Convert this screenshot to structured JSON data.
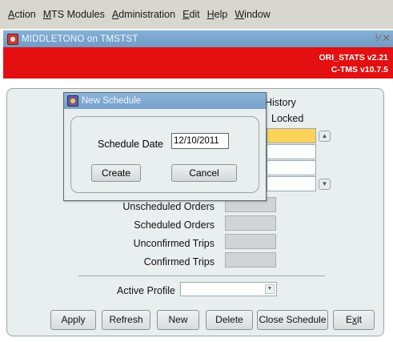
{
  "menubar": {
    "items": [
      {
        "prefix": "",
        "accel": "A",
        "rest": "ction"
      },
      {
        "prefix": "",
        "accel": "M",
        "rest": "TS Modules"
      },
      {
        "prefix": "",
        "accel": "A",
        "rest": "dministration"
      },
      {
        "prefix": "",
        "accel": "E",
        "rest": "dit"
      },
      {
        "prefix": "",
        "accel": "H",
        "rest": "elp"
      },
      {
        "prefix": "",
        "accel": "W",
        "rest": "indow"
      }
    ]
  },
  "window": {
    "title": "MIDDLETONO on TMSTST",
    "min_glyph": "⅟",
    "close_glyph": "✕",
    "version_line1": "ORI_STATS v2.21",
    "version_line2": "C-TMS v10.7.5"
  },
  "main": {
    "history_label": "History",
    "locked_label": "Locked",
    "unscheduled_orders_label": "Unscheduled Orders",
    "scheduled_orders_label": "Scheduled Orders",
    "unconfirmed_trips_label": "Unconfirmed Trips",
    "confirmed_trips_label": "Confirmed Trips",
    "active_profile_label": "Active Profile",
    "active_profile_value": ""
  },
  "buttons": {
    "apply": "Apply",
    "refresh": "Refresh",
    "new": "New",
    "delete": "Delete",
    "close_schedule": "Close Schedule",
    "exit_prefix": "E",
    "exit_accel": "x",
    "exit_rest": "it"
  },
  "dialog": {
    "title": "New Schedule",
    "schedule_date_label": "Schedule Date",
    "schedule_date_value": "12/10/2011",
    "create_label": "Create",
    "cancel_label": "Cancel"
  },
  "colors": {
    "menubar_bg": "#d7d6cf",
    "title_bar": "#7aa6cf",
    "banner_red": "#e30f10",
    "panel_bg": "#e9eeef",
    "highlight_yellow": "#fdd35a"
  }
}
